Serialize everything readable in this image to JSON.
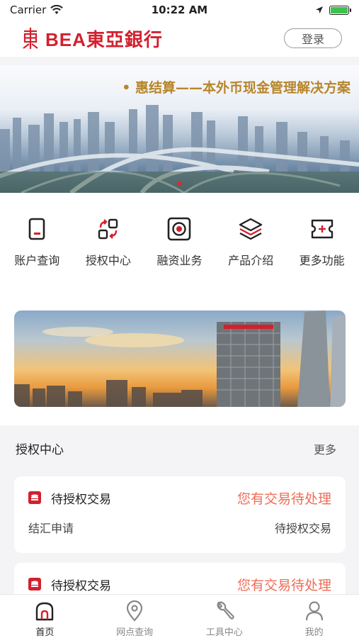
{
  "status_bar": {
    "carrier": "Carrier",
    "time": "10:22 AM"
  },
  "header": {
    "brand": "BEA東亞銀行",
    "login_label": "登录",
    "brand_color": "#d3202f"
  },
  "banner": {
    "title": "• 惠结算——本外币现金管理解决方案",
    "slides": 3,
    "active_slide": 1
  },
  "quick_menu": {
    "items": [
      {
        "label": "账户查询",
        "icon": "account-icon"
      },
      {
        "label": "授权中心",
        "icon": "authorize-icon"
      },
      {
        "label": "融资业务",
        "icon": "financing-icon"
      },
      {
        "label": "产品介绍",
        "icon": "products-icon"
      },
      {
        "label": "更多功能",
        "icon": "more-functions-icon"
      }
    ]
  },
  "auth_section": {
    "title": "授权中心",
    "more_label": "更多",
    "cards": [
      {
        "title": "待授权交易",
        "status": "您有交易待处理",
        "type": "结汇申请",
        "category": "待授权交易"
      },
      {
        "title": "待授权交易",
        "status": "您有交易待处理"
      }
    ]
  },
  "tabbar": {
    "items": [
      {
        "label": "首页",
        "icon": "home-icon",
        "active": true
      },
      {
        "label": "网点查询",
        "icon": "location-icon",
        "active": false
      },
      {
        "label": "工具中心",
        "icon": "wrench-icon",
        "active": false
      },
      {
        "label": "我的",
        "icon": "user-icon",
        "active": false
      }
    ]
  },
  "colors": {
    "accent": "#d3202f",
    "pending": "#ef6c57",
    "banner_title": "#b7862b"
  }
}
